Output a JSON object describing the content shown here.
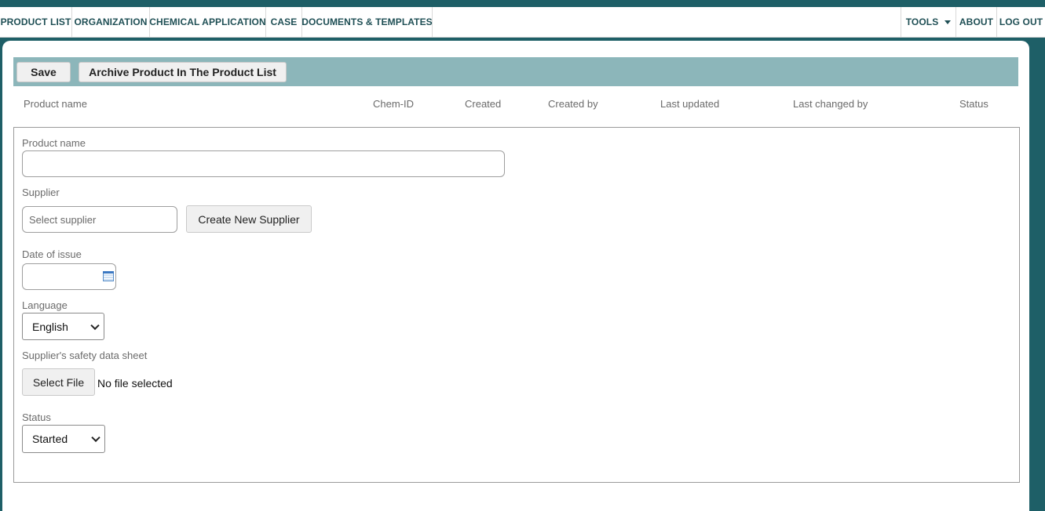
{
  "nav": {
    "left": [
      "PRODUCT LIST",
      "ORGANIZATION",
      "CHEMICAL APPLICATION",
      "CASE",
      "DOCUMENTS & TEMPLATES"
    ],
    "tools": "TOOLS",
    "about": "ABOUT",
    "logout": "LOG OUT"
  },
  "toolbar": {
    "save_label": "Save",
    "archive_label": "Archive Product In The Product List"
  },
  "columns": {
    "product_name": "Product name",
    "chem_id": "Chem-ID",
    "created": "Created",
    "created_by": "Created by",
    "last_updated": "Last updated",
    "last_changed_by": "Last changed by",
    "status": "Status"
  },
  "form": {
    "product_name_label": "Product name",
    "product_name_value": "",
    "supplier_label": "Supplier",
    "supplier_placeholder": "Select supplier",
    "create_supplier_label": "Create New Supplier",
    "date_label": "Date of issue",
    "date_value": "",
    "language_label": "Language",
    "language_value": "English",
    "sds_label": "Supplier's safety data sheet",
    "select_file_label": "Select File",
    "no_file_text": "No file selected",
    "status_label": "Status",
    "status_value": "Started"
  },
  "colors": {
    "brand": "#1e5f67",
    "toolbar": "#8cb6ba",
    "nav_text": "#1f4f55"
  },
  "icons": {
    "calendar": "calendar-icon",
    "dropdown": "chevron-down-icon"
  }
}
